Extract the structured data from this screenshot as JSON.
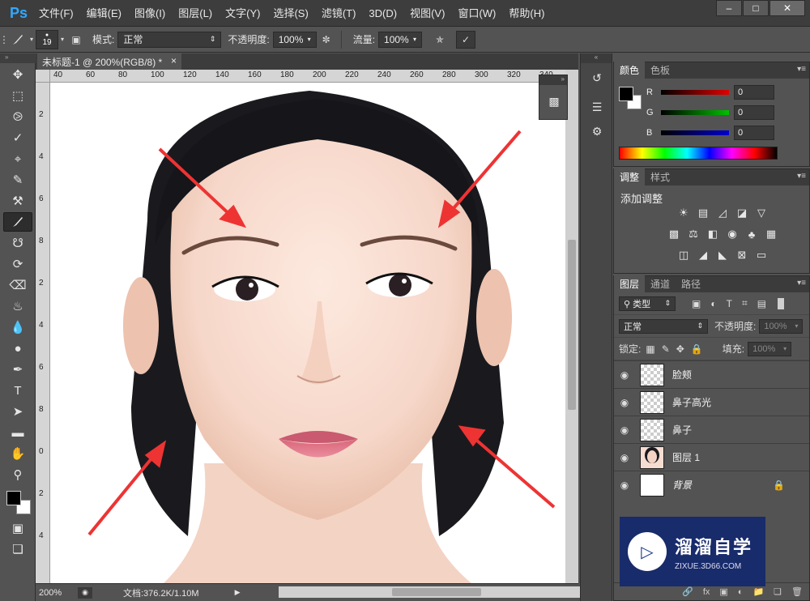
{
  "app": {
    "logo": "Ps",
    "menus": [
      "文件(F)",
      "编辑(E)",
      "图像(I)",
      "图层(L)",
      "文字(Y)",
      "选择(S)",
      "滤镜(T)",
      "3D(D)",
      "视图(V)",
      "窗口(W)",
      "帮助(H)"
    ],
    "window_buttons": [
      "minimize-icon",
      "maximize-icon",
      "close-icon"
    ]
  },
  "options": {
    "brush_size": "19",
    "mode_label": "模式:",
    "mode_value": "正常",
    "opacity_label": "不透明度:",
    "opacity_value": "100%",
    "flow_label": "流量:",
    "flow_value": "100%"
  },
  "document": {
    "tab_title": "未标题-1 @ 200%(RGB/8) *",
    "ruler_top": [
      "40",
      "60",
      "80",
      "100",
      "120",
      "140",
      "160",
      "180",
      "200",
      "220",
      "240",
      "260",
      "280",
      "300",
      "320",
      "340"
    ],
    "ruler_left": [
      "2",
      "4",
      "6",
      "8",
      "2",
      "4",
      "6",
      "8",
      "0",
      "2",
      "4"
    ],
    "zoom": "200%",
    "doc_size": "文档:376.2K/1.10M"
  },
  "color_panel": {
    "tabs": [
      "颜色",
      "色板"
    ],
    "channels": [
      {
        "name": "R",
        "value": "0",
        "color": "#e00000"
      },
      {
        "name": "G",
        "value": "0",
        "color": "#00c000"
      },
      {
        "name": "B",
        "value": "0",
        "color": "#0000d0"
      }
    ]
  },
  "adjustments_panel": {
    "tabs": [
      "调整",
      "样式"
    ],
    "title": "添加调整",
    "row1": [
      "brightness-icon",
      "levels-icon",
      "curves-icon",
      "exposure-icon",
      "vibrance-icon"
    ],
    "row2": [
      "hue-sat-icon",
      "color-balance-icon",
      "bw-icon",
      "photo-filter-icon",
      "channel-mixer-icon",
      "color-lookup-icon"
    ],
    "row3": [
      "invert-icon",
      "posterize-icon",
      "threshold-icon",
      "selective-color-icon",
      "gradient-map-icon"
    ]
  },
  "layers_panel": {
    "tabs": [
      "图层",
      "通道",
      "路径"
    ],
    "filter_label": "类型",
    "blend_mode": "正常",
    "opacity_label": "不透明度:",
    "opacity_value": "100%",
    "lock_label": "锁定:",
    "fill_label": "填充:",
    "fill_value": "100%",
    "layers": [
      {
        "name": "脸颊",
        "thumb": "transparent"
      },
      {
        "name": "鼻子高光",
        "thumb": "transparent"
      },
      {
        "name": "鼻子",
        "thumb": "transparent"
      },
      {
        "name": "图层 1",
        "thumb": "photo"
      },
      {
        "name": "背景",
        "thumb": "white",
        "locked": true
      }
    ]
  },
  "watermark": {
    "name": "溜溜自学",
    "url": "ZIXUE.3D66.COM"
  }
}
